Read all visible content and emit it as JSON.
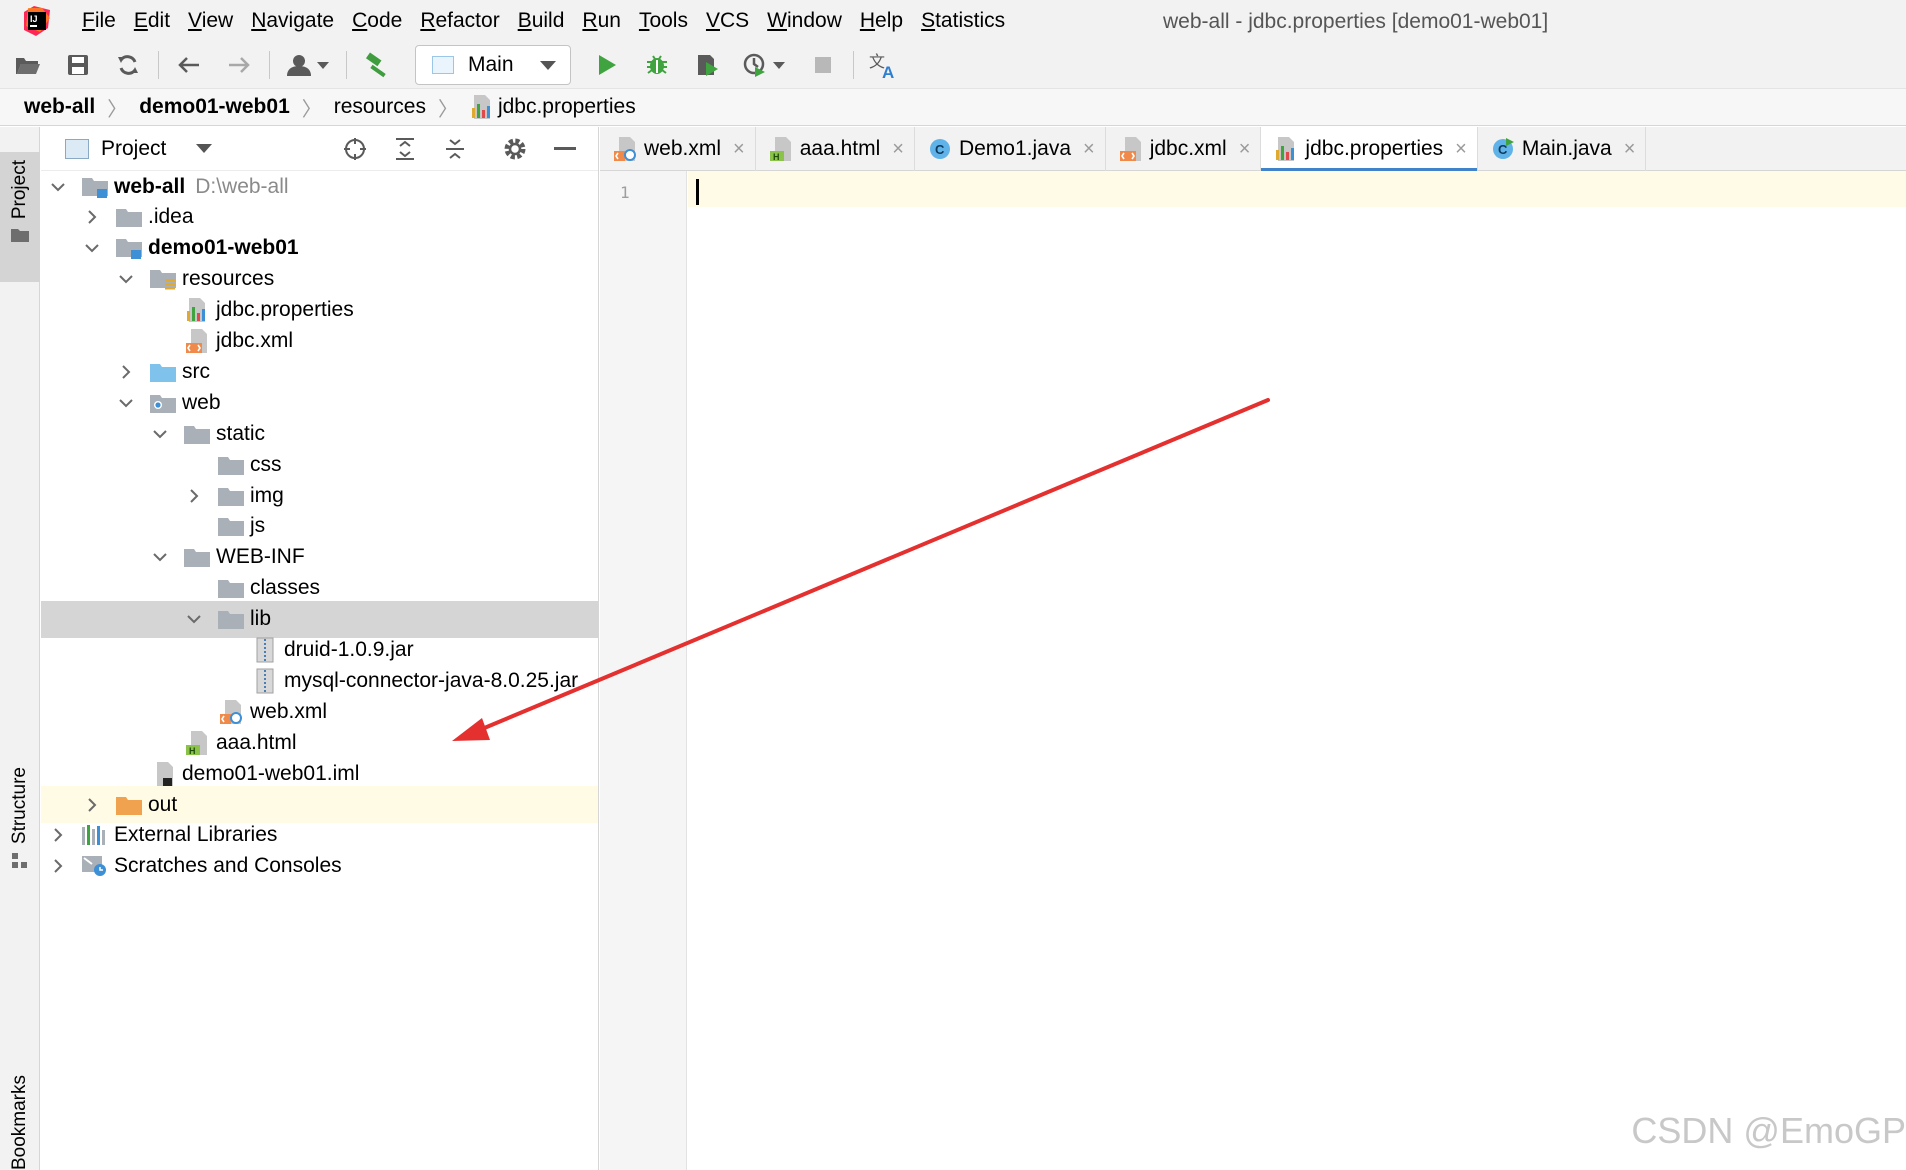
{
  "menubar": {
    "items": [
      {
        "label": "File",
        "mnemonic": "F",
        "rest": "ile"
      },
      {
        "label": "Edit",
        "mnemonic": "E",
        "rest": "dit"
      },
      {
        "label": "View",
        "mnemonic": "V",
        "rest": "iew"
      },
      {
        "label": "Navigate",
        "mnemonic": "N",
        "rest": "avigate"
      },
      {
        "label": "Code",
        "mnemonic": "C",
        "rest": "ode"
      },
      {
        "label": "Refactor",
        "mnemonic": "R",
        "rest": "efactor"
      },
      {
        "label": "Build",
        "mnemonic": "B",
        "rest": "uild"
      },
      {
        "label": "Run",
        "mnemonic": "R",
        "rest": "un"
      },
      {
        "label": "Tools",
        "mnemonic": "T",
        "rest": "ools"
      },
      {
        "label": "VCS",
        "mnemonic": "V",
        "rest": "CS"
      },
      {
        "label": "Window",
        "mnemonic": "W",
        "rest": "indow"
      },
      {
        "label": "Help",
        "mnemonic": "H",
        "rest": "elp"
      },
      {
        "label": "Statistics",
        "mnemonic": "S",
        "rest": "tatistics"
      }
    ],
    "window_title": "web-all - jdbc.properties [demo01-web01]"
  },
  "toolbar": {
    "run_config": "Main"
  },
  "breadcrumb": [
    "web-all",
    "demo01-web01",
    "resources",
    "jdbc.properties"
  ],
  "left_strip": {
    "project_tab": "Project",
    "structure_tab": "Structure",
    "bookmarks_tab": "Bookmarks"
  },
  "project_panel": {
    "title": "Project",
    "tree": [
      {
        "label": "web-all",
        "hint": "D:\\web-all",
        "depth": 0,
        "expand": "open",
        "icon": "module-folder",
        "bold": true
      },
      {
        "label": ".idea",
        "depth": 1,
        "expand": "closed",
        "icon": "folder"
      },
      {
        "label": "demo01-web01",
        "depth": 1,
        "expand": "open",
        "icon": "module-folder",
        "bold": true
      },
      {
        "label": "resources",
        "depth": 2,
        "expand": "open",
        "icon": "resources-folder"
      },
      {
        "label": "jdbc.properties",
        "depth": 3,
        "expand": "none",
        "icon": "properties-file"
      },
      {
        "label": "jdbc.xml",
        "depth": 3,
        "expand": "none",
        "icon": "xml-file"
      },
      {
        "label": "src",
        "depth": 2,
        "expand": "closed",
        "icon": "source-folder"
      },
      {
        "label": "web",
        "depth": 2,
        "expand": "open",
        "icon": "web-folder"
      },
      {
        "label": "static",
        "depth": 3,
        "expand": "open",
        "icon": "folder"
      },
      {
        "label": "css",
        "depth": 4,
        "expand": "none",
        "icon": "folder"
      },
      {
        "label": "img",
        "depth": 4,
        "expand": "closed",
        "icon": "folder"
      },
      {
        "label": "js",
        "depth": 4,
        "expand": "none",
        "icon": "folder"
      },
      {
        "label": "WEB-INF",
        "depth": 3,
        "expand": "open",
        "icon": "folder"
      },
      {
        "label": "classes",
        "depth": 4,
        "expand": "none",
        "icon": "folder"
      },
      {
        "label": "lib",
        "depth": 4,
        "expand": "open",
        "icon": "folder",
        "selected": true
      },
      {
        "label": "druid-1.0.9.jar",
        "depth": 5,
        "expand": "none",
        "icon": "jar-file"
      },
      {
        "label": "mysql-connector-java-8.0.25.jar",
        "depth": 5,
        "expand": "none",
        "icon": "jar-file"
      },
      {
        "label": "web.xml",
        "depth": 4,
        "expand": "none",
        "icon": "webxml-file"
      },
      {
        "label": "aaa.html",
        "depth": 3,
        "expand": "none",
        "icon": "html-file"
      },
      {
        "label": "demo01-web01.iml",
        "depth": 2,
        "expand": "none",
        "icon": "iml-file"
      },
      {
        "label": "out",
        "depth": 1,
        "expand": "closed",
        "icon": "excluded-folder",
        "yellow": true
      },
      {
        "label": "External Libraries",
        "depth": 0,
        "expand": "closed",
        "icon": "libraries"
      },
      {
        "label": "Scratches and Consoles",
        "depth": 0,
        "expand": "closed",
        "icon": "scratches"
      }
    ]
  },
  "editor": {
    "tabs": [
      {
        "label": "web.xml",
        "icon": "webxml-file"
      },
      {
        "label": "aaa.html",
        "icon": "html-file"
      },
      {
        "label": "Demo1.java",
        "icon": "java-class"
      },
      {
        "label": "jdbc.xml",
        "icon": "xml-file"
      },
      {
        "label": "jdbc.properties",
        "icon": "properties-file",
        "active": true
      },
      {
        "label": "Main.java",
        "icon": "java-main"
      }
    ],
    "close_glyph": "×",
    "line_number": "1"
  },
  "annotation": {
    "arrow_color": "#e53030"
  },
  "watermark": "CSDN @EmoGP",
  "colors": {
    "selection": "#d5d5d5",
    "active_tab_underline": "#4083c9",
    "run_green": "#3fa33f",
    "folder_gray": "#a9b0b8",
    "excluded_orange": "#f0a24e"
  }
}
